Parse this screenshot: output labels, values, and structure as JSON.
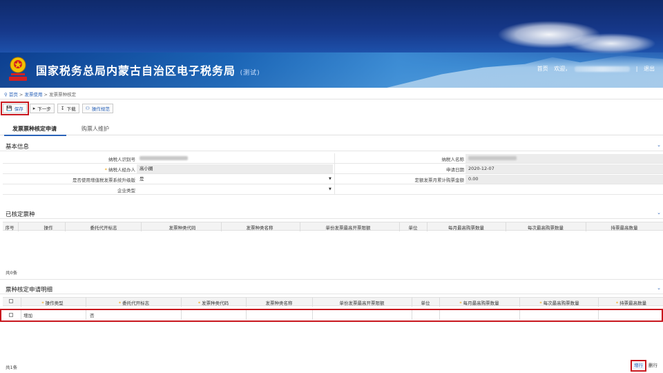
{
  "header": {
    "title": "国家税务总局内蒙古自治区电子税务局",
    "title_suffix": "(测试)",
    "links": {
      "home": "首页",
      "welcome": "欢迎，",
      "logout": "退出",
      "separator": "|"
    }
  },
  "breadcrumb": [
    "首页",
    "发票使用",
    "发票票种核定"
  ],
  "breadcrumb_sep": ">",
  "toolbar": {
    "save": "保存",
    "next": "下一步",
    "download": "下载",
    "guide": "操作规范"
  },
  "tabs": [
    "发票票种核定申请",
    "购票人维护"
  ],
  "basic_info": {
    "title": "基本信息",
    "taxpayer_id_label": "纳税人识别号",
    "taxpayer_name_label": "纳税人名称",
    "agent_label": "纳税人经办人",
    "agent_value": "高小圈",
    "apply_date_label": "申请日期",
    "apply_date_value": "2020-12-07",
    "upgrade_label": "是否使用增值税发票系统升级版",
    "upgrade_value": "是",
    "quota_label": "定额发票月累计购票金额",
    "quota_value": "0.00",
    "company_type_label": "企业类型",
    "company_type_value": ""
  },
  "approved": {
    "title": "已核定票种",
    "columns": [
      "序号",
      "操作",
      "委托代开标志",
      "发票种类代码",
      "发票种类名称",
      "单份发票最高开票限额",
      "单位",
      "每月最高购票数量",
      "每次最高购票数量",
      "持票最高数量"
    ],
    "count": "共0条"
  },
  "detail": {
    "title": "票种核定申请明细",
    "columns": [
      "操作类型",
      "委托代开标志",
      "发票种类代码",
      "发票种类名称",
      "单份发票最高开票限额",
      "单位",
      "每月最高购票数量",
      "每次最高购票数量",
      "持票最高数量"
    ],
    "required_mark": "*",
    "rows": [
      {
        "op_type": "增加",
        "delegate": "否"
      }
    ],
    "count": "共1条",
    "add_row": "增行",
    "del_row": "删行"
  }
}
